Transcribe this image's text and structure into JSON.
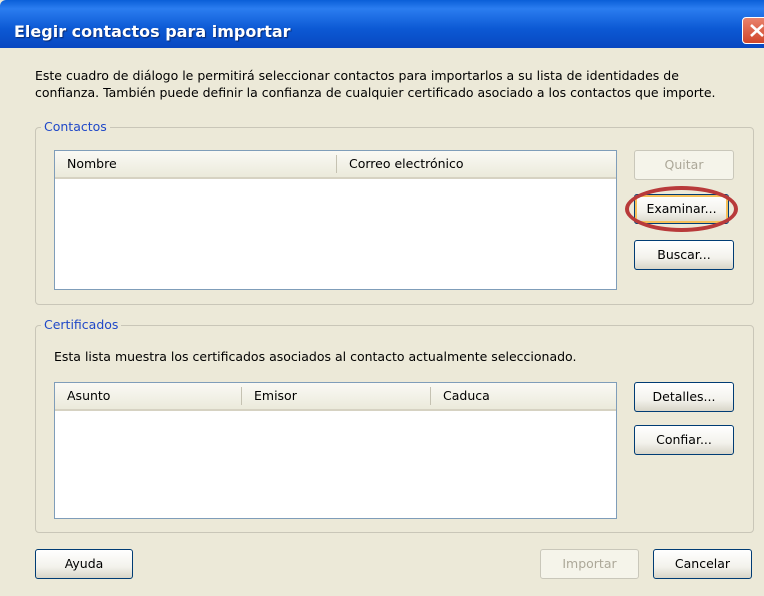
{
  "window": {
    "title": "Elegir contactos para importar"
  },
  "intro": "Este cuadro de diálogo le permitirá seleccionar contactos para importarlos a su lista de identidades de confianza. También puede definir la confianza de cualquier certificado asociado a los contactos que importe.",
  "contacts": {
    "legend": "Contactos",
    "columns": [
      "Nombre",
      "Correo electrónico"
    ],
    "rows": [],
    "buttons": {
      "remove": "Quitar",
      "browse": "Examinar...",
      "search": "Buscar..."
    }
  },
  "certificates": {
    "legend": "Certificados",
    "description": "Esta lista muestra los certificados asociados al contacto actualmente seleccionado.",
    "columns": [
      "Asunto",
      "Emisor",
      "Caduca"
    ],
    "rows": [],
    "buttons": {
      "details": "Detalles...",
      "trust": "Confiar..."
    }
  },
  "footer": {
    "help": "Ayuda",
    "import": "Importar",
    "cancel": "Cancelar"
  },
  "colors": {
    "title_bar": "#0c59d4",
    "group_legend": "#1f48c8",
    "highlight_ring": "#b83a3a"
  }
}
